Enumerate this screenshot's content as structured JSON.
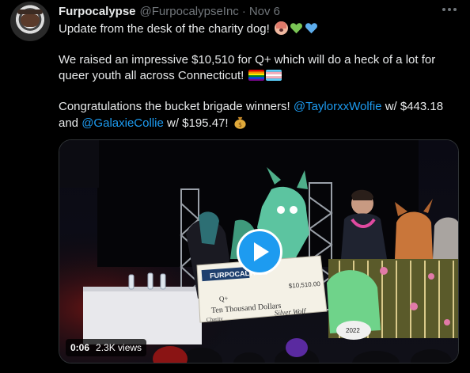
{
  "author": {
    "display_name": "Furpocalypse",
    "handle": "@FurpocalypseInc",
    "separator": "·",
    "time": "Nov 6"
  },
  "tweet": {
    "line1": "Update from the desk of the charity dog!",
    "line2": "We raised an impressive $10,510 for Q+ which will do a heck of a lot for",
    "line3": "queer youth all across Connecticut!",
    "line4_pre": "Congratulations the bucket brigade winners!",
    "mention1": "@TaylorxxWolfie",
    "amount1": "w/ $443.18",
    "line5_pre": "and",
    "mention2": "@GalaxieCollie",
    "amount2": "w/ $195.47!",
    "emojis": [
      "dog-face",
      "green-heart",
      "blue-heart",
      "rainbow-flag",
      "transgender-flag",
      "money-bag"
    ]
  },
  "media": {
    "type": "video",
    "time": "0:06",
    "views": "2.3K views",
    "check": {
      "org": "FURPOCALYPSE",
      "payee": "Q+",
      "amount_words": "Ten Thousand Dollars",
      "amount_number": "$10,510.00",
      "memo": "Charity",
      "signature": "Silver Wolf"
    },
    "badge_number": "2022"
  },
  "colors": {
    "background": "#000000",
    "text": "#e7e9ea",
    "muted": "#71767b",
    "accent": "#1d9bf0"
  }
}
